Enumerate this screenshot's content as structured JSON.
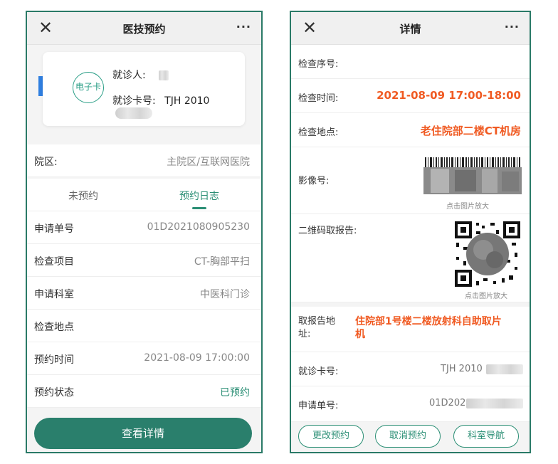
{
  "left": {
    "header": {
      "title": "医技预约",
      "close_glyph": "✕",
      "more_glyph": "···"
    },
    "card": {
      "badge": "电子卡",
      "patient_label": "就诊人:",
      "card_no_label": "就诊卡号:",
      "card_no_value": "TJH 2010"
    },
    "campus": {
      "label": "院区:",
      "value": "主院区/互联网医院"
    },
    "tabs": [
      {
        "label": "未预约"
      },
      {
        "label": "预约日志"
      }
    ],
    "rows": [
      {
        "label": "申请单号",
        "value": "01D2021080905230"
      },
      {
        "label": "检查项目",
        "value": "CT-胸部平扫"
      },
      {
        "label": "申请科室",
        "value": "中医科门诊"
      },
      {
        "label": "检查地点",
        "value": ""
      },
      {
        "label": "预约时间",
        "value": "2021-08-09 17:00:00"
      },
      {
        "label": "预约状态",
        "value": "已预约"
      }
    ],
    "action_button": "查看详情"
  },
  "right": {
    "header": {
      "title": "详情",
      "close_glyph": "✕",
      "more_glyph": "···"
    },
    "exam_seq": {
      "label": "检查序号:"
    },
    "exam_time": {
      "label": "检查时间:",
      "value": "2021-08-09 17:00-18:00"
    },
    "exam_location": {
      "label": "检查地点:",
      "value": "老住院部二楼CT机房"
    },
    "image_no": {
      "label": "影像号:",
      "hint": "点击图片放大"
    },
    "qr_report": {
      "label": "二维码取报告:",
      "hint": "点击图片放大"
    },
    "report_address": {
      "label_line1": "取报告地",
      "label_line2": "址:",
      "value_line1": "住院部1号楼二楼放射科自助取片",
      "value_line2": "机"
    },
    "card_no": {
      "label": "就诊卡号:",
      "value": "TJH 2010"
    },
    "request_no": {
      "label": "申请单号:",
      "value": "01D202"
    },
    "buttons": [
      {
        "label": "更改预约"
      },
      {
        "label": "取消预约"
      },
      {
        "label": "科室导航"
      }
    ]
  },
  "colors": {
    "accent_green": "#2a7f6c",
    "highlight_orange": "#f05a22",
    "card_tab_blue": "#2f7fe0"
  }
}
